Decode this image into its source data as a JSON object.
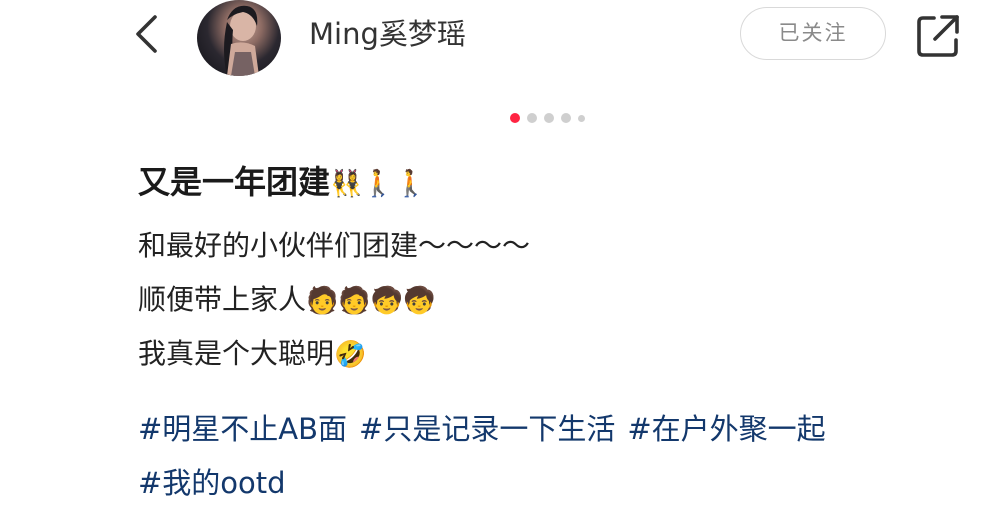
{
  "header": {
    "back_icon": "chevron-left-icon",
    "username": "Ming奚梦瑶",
    "follow_label": "已关注",
    "share_icon": "share-icon"
  },
  "carousel": {
    "total_dots": 5,
    "active_index": 0
  },
  "post": {
    "title_text": "又是一年团建",
    "title_emojis": "👯‍♀️🚶🚶",
    "lines": [
      {
        "text": "和最好的小伙伴们团建～～～～",
        "emojis": ""
      },
      {
        "text": "顺便带上家人",
        "emojis": "🧑🧑🧒🧒"
      },
      {
        "text": "我真是个大聪明",
        "emojis": "🤣"
      }
    ],
    "tags_row1": [
      "#明星不止AB面",
      "#只是记录一下生活",
      "#在户外聚一起"
    ],
    "tags_row2": [
      "#我的ootd"
    ]
  },
  "colors": {
    "accent": "#ff2442",
    "tag": "#13386c",
    "follow_border": "#d9d9d9"
  }
}
